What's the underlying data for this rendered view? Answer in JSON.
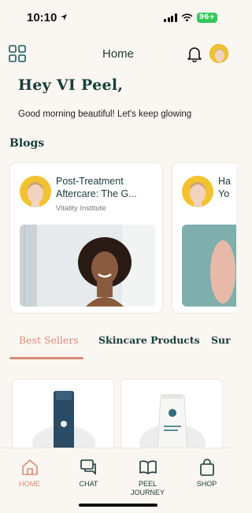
{
  "status_bar": {
    "time": "10:10",
    "battery": "96+"
  },
  "header": {
    "title": "Home"
  },
  "greeting": {
    "title": "Hey VI Peel,",
    "subtitle": "Good morning beautiful! Let's keep glowing"
  },
  "blogs": {
    "section_title": "Blogs",
    "items": [
      {
        "title": "Post-Treatment Aftercare: The G...",
        "source": "Vitality Institute"
      },
      {
        "title": "Ha Yo",
        "source": ""
      }
    ]
  },
  "tabs": [
    {
      "label": "Best Sellers"
    },
    {
      "label": "Skincare Products"
    },
    {
      "label": "Sur"
    }
  ],
  "bottom_nav": [
    {
      "label": "HOME",
      "icon": "home-icon"
    },
    {
      "label": "CHAT",
      "icon": "chat-icon"
    },
    {
      "label": "PEEL JOURNEY",
      "icon": "book-icon"
    },
    {
      "label": "SHOP",
      "icon": "bag-icon"
    }
  ],
  "colors": {
    "accent": "#D98B7A",
    "primary": "#1B3B3A",
    "background": "#FAF6F1",
    "avatar_bg": "#F2C230"
  }
}
